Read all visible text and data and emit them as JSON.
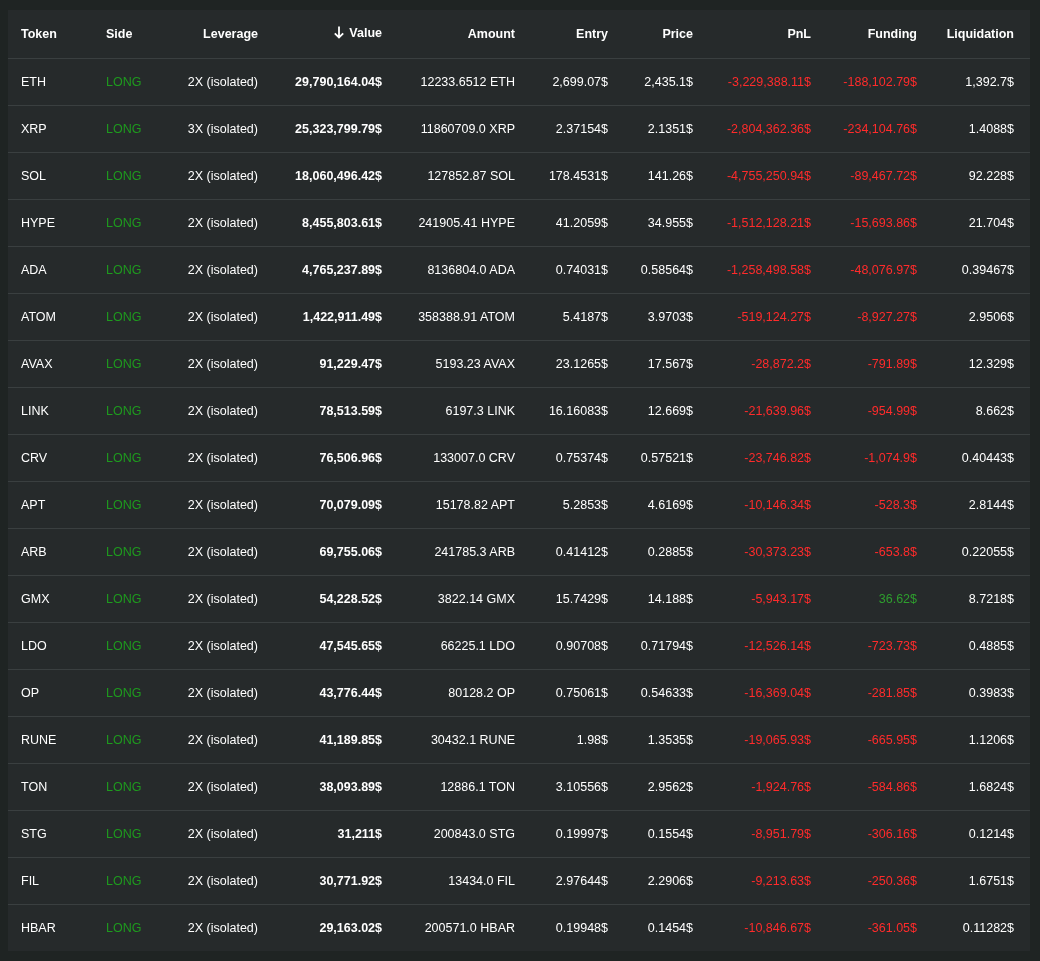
{
  "table": {
    "columns": [
      {
        "label": "Token",
        "sorted": false
      },
      {
        "label": "Side",
        "sorted": false
      },
      {
        "label": "Leverage",
        "sorted": false
      },
      {
        "label": "Value",
        "sorted": true
      },
      {
        "label": "Amount",
        "sorted": false
      },
      {
        "label": "Entry",
        "sorted": false
      },
      {
        "label": "Price",
        "sorted": false
      },
      {
        "label": "PnL",
        "sorted": false
      },
      {
        "label": "Funding",
        "sorted": false
      },
      {
        "label": "Liquidation",
        "sorted": false
      }
    ],
    "rows": [
      {
        "token": "ETH",
        "side": "LONG",
        "leverage": "2X (isolated)",
        "value": "29,790,164.04$",
        "amount": "12233.6512 ETH",
        "entry": "2,699.07$",
        "price": "2,435.1$",
        "pnl": "-3,229,388.11$",
        "pnl_positive": false,
        "funding": "-188,102.79$",
        "funding_positive": false,
        "liquidation": "1,392.7$"
      },
      {
        "token": "XRP",
        "side": "LONG",
        "leverage": "3X (isolated)",
        "value": "25,323,799.79$",
        "amount": "11860709.0 XRP",
        "entry": "2.37154$",
        "price": "2.1351$",
        "pnl": "-2,804,362.36$",
        "pnl_positive": false,
        "funding": "-234,104.76$",
        "funding_positive": false,
        "liquidation": "1.4088$"
      },
      {
        "token": "SOL",
        "side": "LONG",
        "leverage": "2X (isolated)",
        "value": "18,060,496.42$",
        "amount": "127852.87 SOL",
        "entry": "178.4531$",
        "price": "141.26$",
        "pnl": "-4,755,250.94$",
        "pnl_positive": false,
        "funding": "-89,467.72$",
        "funding_positive": false,
        "liquidation": "92.228$"
      },
      {
        "token": "HYPE",
        "side": "LONG",
        "leverage": "2X (isolated)",
        "value": "8,455,803.61$",
        "amount": "241905.41 HYPE",
        "entry": "41.2059$",
        "price": "34.955$",
        "pnl": "-1,512,128.21$",
        "pnl_positive": false,
        "funding": "-15,693.86$",
        "funding_positive": false,
        "liquidation": "21.704$"
      },
      {
        "token": "ADA",
        "side": "LONG",
        "leverage": "2X (isolated)",
        "value": "4,765,237.89$",
        "amount": "8136804.0 ADA",
        "entry": "0.74031$",
        "price": "0.58564$",
        "pnl": "-1,258,498.58$",
        "pnl_positive": false,
        "funding": "-48,076.97$",
        "funding_positive": false,
        "liquidation": "0.39467$"
      },
      {
        "token": "ATOM",
        "side": "LONG",
        "leverage": "2X (isolated)",
        "value": "1,422,911.49$",
        "amount": "358388.91 ATOM",
        "entry": "5.4187$",
        "price": "3.9703$",
        "pnl": "-519,124.27$",
        "pnl_positive": false,
        "funding": "-8,927.27$",
        "funding_positive": false,
        "liquidation": "2.9506$"
      },
      {
        "token": "AVAX",
        "side": "LONG",
        "leverage": "2X (isolated)",
        "value": "91,229.47$",
        "amount": "5193.23 AVAX",
        "entry": "23.1265$",
        "price": "17.567$",
        "pnl": "-28,872.2$",
        "pnl_positive": false,
        "funding": "-791.89$",
        "funding_positive": false,
        "liquidation": "12.329$"
      },
      {
        "token": "LINK",
        "side": "LONG",
        "leverage": "2X (isolated)",
        "value": "78,513.59$",
        "amount": "6197.3 LINK",
        "entry": "16.16083$",
        "price": "12.669$",
        "pnl": "-21,639.96$",
        "pnl_positive": false,
        "funding": "-954.99$",
        "funding_positive": false,
        "liquidation": "8.662$"
      },
      {
        "token": "CRV",
        "side": "LONG",
        "leverage": "2X (isolated)",
        "value": "76,506.96$",
        "amount": "133007.0 CRV",
        "entry": "0.75374$",
        "price": "0.57521$",
        "pnl": "-23,746.82$",
        "pnl_positive": false,
        "funding": "-1,074.9$",
        "funding_positive": false,
        "liquidation": "0.40443$"
      },
      {
        "token": "APT",
        "side": "LONG",
        "leverage": "2X (isolated)",
        "value": "70,079.09$",
        "amount": "15178.82 APT",
        "entry": "5.2853$",
        "price": "4.6169$",
        "pnl": "-10,146.34$",
        "pnl_positive": false,
        "funding": "-528.3$",
        "funding_positive": false,
        "liquidation": "2.8144$"
      },
      {
        "token": "ARB",
        "side": "LONG",
        "leverage": "2X (isolated)",
        "value": "69,755.06$",
        "amount": "241785.3 ARB",
        "entry": "0.41412$",
        "price": "0.2885$",
        "pnl": "-30,373.23$",
        "pnl_positive": false,
        "funding": "-653.8$",
        "funding_positive": false,
        "liquidation": "0.22055$"
      },
      {
        "token": "GMX",
        "side": "LONG",
        "leverage": "2X (isolated)",
        "value": "54,228.52$",
        "amount": "3822.14 GMX",
        "entry": "15.7429$",
        "price": "14.188$",
        "pnl": "-5,943.17$",
        "pnl_positive": false,
        "funding": "36.62$",
        "funding_positive": true,
        "liquidation": "8.7218$"
      },
      {
        "token": "LDO",
        "side": "LONG",
        "leverage": "2X (isolated)",
        "value": "47,545.65$",
        "amount": "66225.1 LDO",
        "entry": "0.90708$",
        "price": "0.71794$",
        "pnl": "-12,526.14$",
        "pnl_positive": false,
        "funding": "-723.73$",
        "funding_positive": false,
        "liquidation": "0.4885$"
      },
      {
        "token": "OP",
        "side": "LONG",
        "leverage": "2X (isolated)",
        "value": "43,776.44$",
        "amount": "80128.2 OP",
        "entry": "0.75061$",
        "price": "0.54633$",
        "pnl": "-16,369.04$",
        "pnl_positive": false,
        "funding": "-281.85$",
        "funding_positive": false,
        "liquidation": "0.3983$"
      },
      {
        "token": "RUNE",
        "side": "LONG",
        "leverage": "2X (isolated)",
        "value": "41,189.85$",
        "amount": "30432.1 RUNE",
        "entry": "1.98$",
        "price": "1.3535$",
        "pnl": "-19,065.93$",
        "pnl_positive": false,
        "funding": "-665.95$",
        "funding_positive": false,
        "liquidation": "1.1206$"
      },
      {
        "token": "TON",
        "side": "LONG",
        "leverage": "2X (isolated)",
        "value": "38,093.89$",
        "amount": "12886.1 TON",
        "entry": "3.10556$",
        "price": "2.9562$",
        "pnl": "-1,924.76$",
        "pnl_positive": false,
        "funding": "-584.86$",
        "funding_positive": false,
        "liquidation": "1.6824$"
      },
      {
        "token": "STG",
        "side": "LONG",
        "leverage": "2X (isolated)",
        "value": "31,211$",
        "amount": "200843.0 STG",
        "entry": "0.19997$",
        "price": "0.1554$",
        "pnl": "-8,951.79$",
        "pnl_positive": false,
        "funding": "-306.16$",
        "funding_positive": false,
        "liquidation": "0.1214$"
      },
      {
        "token": "FIL",
        "side": "LONG",
        "leverage": "2X (isolated)",
        "value": "30,771.92$",
        "amount": "13434.0 FIL",
        "entry": "2.97644$",
        "price": "2.2906$",
        "pnl": "-9,213.63$",
        "pnl_positive": false,
        "funding": "-250.36$",
        "funding_positive": false,
        "liquidation": "1.6751$"
      },
      {
        "token": "HBAR",
        "side": "LONG",
        "leverage": "2X (isolated)",
        "value": "29,163.02$",
        "amount": "200571.0 HBAR",
        "entry": "0.19948$",
        "price": "0.1454$",
        "pnl": "-10,846.67$",
        "pnl_positive": false,
        "funding": "-361.05$",
        "funding_positive": false,
        "liquidation": "0.11282$"
      }
    ]
  }
}
